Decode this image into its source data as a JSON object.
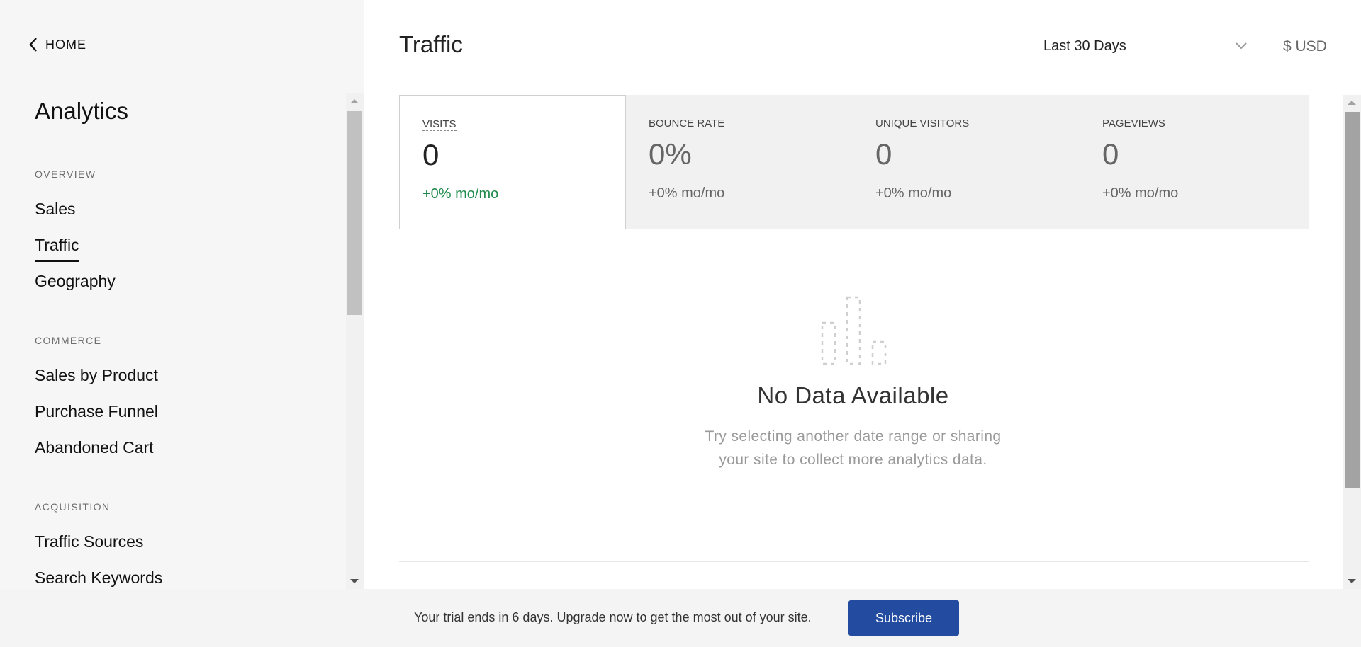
{
  "sidebar": {
    "home_label": "HOME",
    "title": "Analytics",
    "sections": [
      {
        "label": "OVERVIEW",
        "items": [
          "Sales",
          "Traffic",
          "Geography"
        ]
      },
      {
        "label": "COMMERCE",
        "items": [
          "Sales by Product",
          "Purchase Funnel",
          "Abandoned Cart"
        ]
      },
      {
        "label": "ACQUISITION",
        "items": [
          "Traffic Sources",
          "Search Keywords"
        ]
      }
    ],
    "active_item": "Traffic"
  },
  "header": {
    "title": "Traffic",
    "date_range": "Last 30 Days",
    "currency": "$ USD"
  },
  "metrics": [
    {
      "label": "VISITS",
      "value": "0",
      "change": "+0% mo/mo",
      "active": true
    },
    {
      "label": "BOUNCE RATE",
      "value": "0%",
      "change": "+0% mo/mo",
      "active": false
    },
    {
      "label": "UNIQUE VISITORS",
      "value": "0",
      "change": "+0% mo/mo",
      "active": false
    },
    {
      "label": "PAGEVIEWS",
      "value": "0",
      "change": "+0% mo/mo",
      "active": false
    }
  ],
  "empty_state": {
    "icon": "bar-chart-placeholder-icon",
    "title": "No Data Available",
    "line1": "Try selecting another date range or sharing",
    "line2": "your site to collect more analytics data."
  },
  "banner": {
    "message": "Your trial ends in 6 days. Upgrade now to get the most out of your site.",
    "button_label": "Subscribe"
  },
  "colors": {
    "accent_button": "#234b9f",
    "positive_change": "#1f8a4c",
    "sidebar_bg": "#f6f6f6",
    "metrics_bg": "#f1f1f1"
  }
}
